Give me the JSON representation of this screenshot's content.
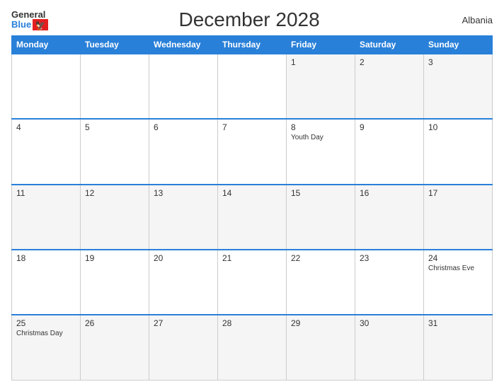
{
  "header": {
    "logo_general": "General",
    "logo_blue": "Blue",
    "title": "December 2028",
    "country": "Albania"
  },
  "days_of_week": [
    "Monday",
    "Tuesday",
    "Wednesday",
    "Thursday",
    "Friday",
    "Saturday",
    "Sunday"
  ],
  "weeks": [
    {
      "days": [
        {
          "num": "",
          "event": ""
        },
        {
          "num": "",
          "event": ""
        },
        {
          "num": "",
          "event": ""
        },
        {
          "num": "",
          "event": ""
        },
        {
          "num": "1",
          "event": ""
        },
        {
          "num": "2",
          "event": ""
        },
        {
          "num": "3",
          "event": ""
        }
      ]
    },
    {
      "days": [
        {
          "num": "4",
          "event": ""
        },
        {
          "num": "5",
          "event": ""
        },
        {
          "num": "6",
          "event": ""
        },
        {
          "num": "7",
          "event": ""
        },
        {
          "num": "8",
          "event": "Youth Day"
        },
        {
          "num": "9",
          "event": ""
        },
        {
          "num": "10",
          "event": ""
        }
      ]
    },
    {
      "days": [
        {
          "num": "11",
          "event": ""
        },
        {
          "num": "12",
          "event": ""
        },
        {
          "num": "13",
          "event": ""
        },
        {
          "num": "14",
          "event": ""
        },
        {
          "num": "15",
          "event": ""
        },
        {
          "num": "16",
          "event": ""
        },
        {
          "num": "17",
          "event": ""
        }
      ]
    },
    {
      "days": [
        {
          "num": "18",
          "event": ""
        },
        {
          "num": "19",
          "event": ""
        },
        {
          "num": "20",
          "event": ""
        },
        {
          "num": "21",
          "event": ""
        },
        {
          "num": "22",
          "event": ""
        },
        {
          "num": "23",
          "event": ""
        },
        {
          "num": "24",
          "event": "Christmas Eve"
        }
      ]
    },
    {
      "days": [
        {
          "num": "25",
          "event": "Christmas Day"
        },
        {
          "num": "26",
          "event": ""
        },
        {
          "num": "27",
          "event": ""
        },
        {
          "num": "28",
          "event": ""
        },
        {
          "num": "29",
          "event": ""
        },
        {
          "num": "30",
          "event": ""
        },
        {
          "num": "31",
          "event": ""
        }
      ]
    }
  ]
}
